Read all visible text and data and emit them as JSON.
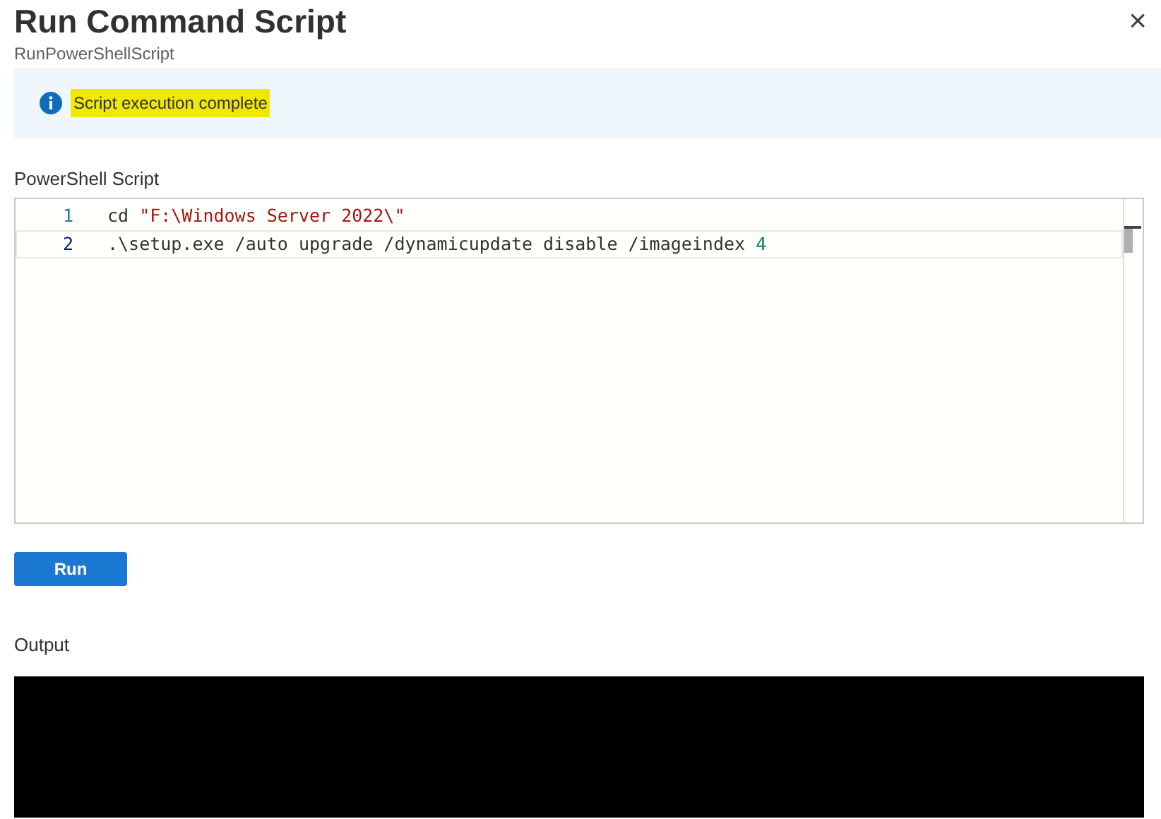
{
  "title": "Run Command Script",
  "subtitle": "RunPowerShellScript",
  "close": "×",
  "banner": {
    "text": "Script execution complete",
    "highlighted": true
  },
  "editor": {
    "label": "PowerShell Script",
    "lines": [
      {
        "number": "1",
        "current": false,
        "tokens": [
          {
            "kind": "plain",
            "text": "cd "
          },
          {
            "kind": "string",
            "text": "\"F:\\Windows Server 2022\\\""
          }
        ]
      },
      {
        "number": "2",
        "current": true,
        "tokens": [
          {
            "kind": "plain",
            "text": ".\\setup.exe /auto upgrade /dynamicupdate disable /imageindex "
          },
          {
            "kind": "number",
            "text": "4"
          }
        ]
      }
    ]
  },
  "run_button": "Run",
  "output": {
    "label": "Output"
  }
}
